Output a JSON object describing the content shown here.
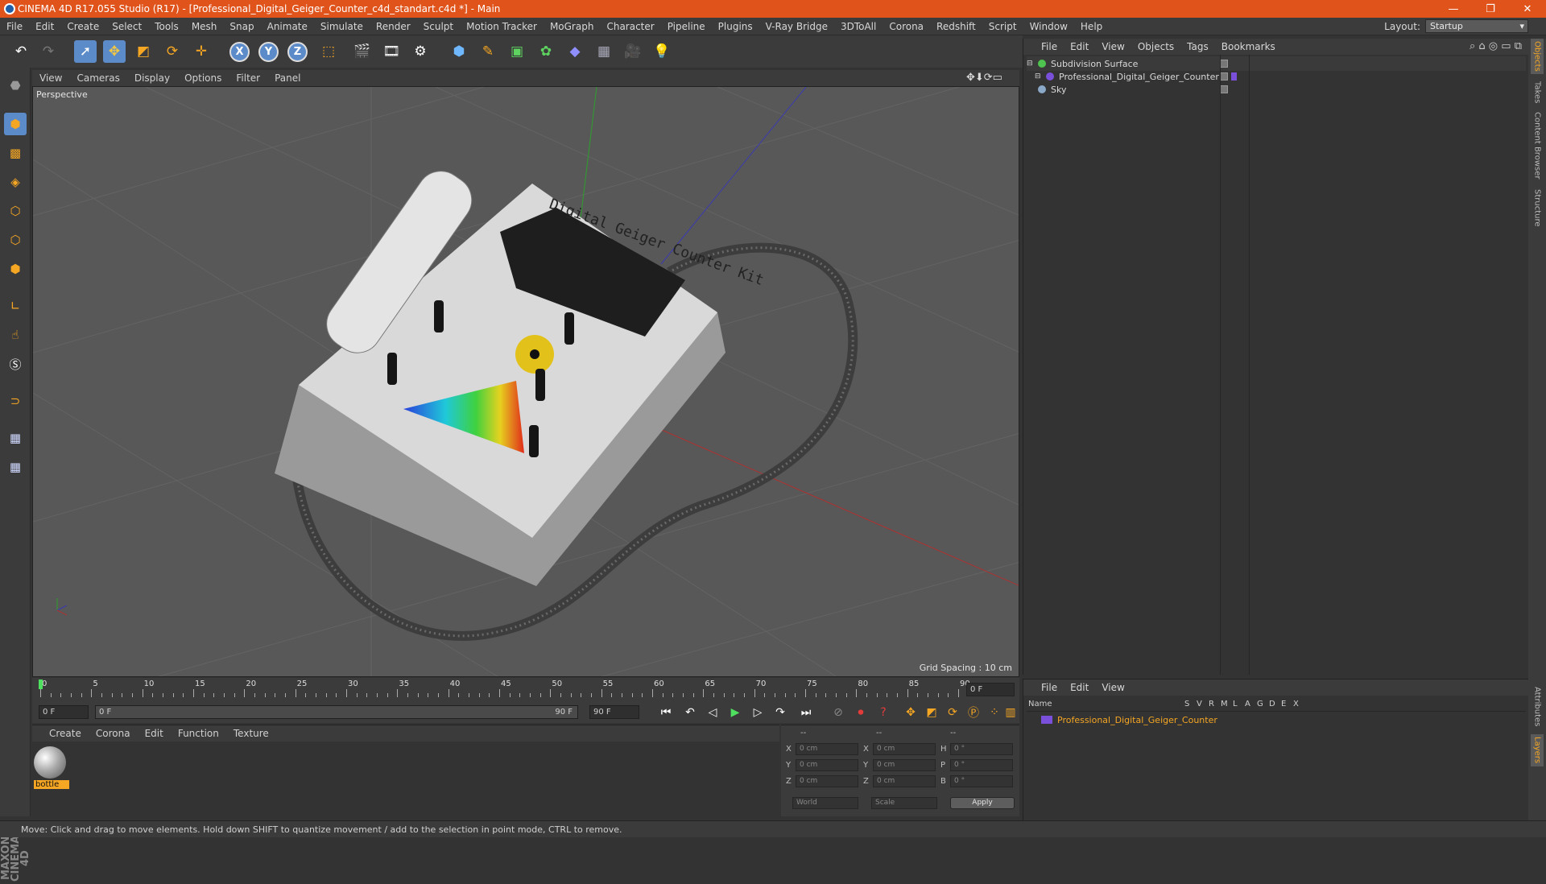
{
  "window": {
    "title": "CINEMA 4D R17.055 Studio (R17) - [Professional_Digital_Geiger_Counter_c4d_standart.c4d *] - Main",
    "minimize": "—",
    "maximize": "❐",
    "close": "✕"
  },
  "menubar": [
    "File",
    "Edit",
    "Create",
    "Select",
    "Tools",
    "Mesh",
    "Snap",
    "Animate",
    "Simulate",
    "Render",
    "Sculpt",
    "Motion Tracker",
    "MoGraph",
    "Character",
    "Pipeline",
    "Plugins",
    "V-Ray Bridge",
    "3DToAll",
    "Corona",
    "Redshift",
    "Script",
    "Window",
    "Help"
  ],
  "layout": {
    "label": "Layout:",
    "value": "Startup"
  },
  "viewport": {
    "menu": [
      "View",
      "Cameras",
      "Display",
      "Options",
      "Filter",
      "Panel"
    ],
    "label": "Perspective",
    "grid_spacing": "Grid Spacing : 10 cm"
  },
  "timeline": {
    "ticks": [
      "0",
      "5",
      "10",
      "15",
      "20",
      "25",
      "30",
      "35",
      "40",
      "45",
      "50",
      "55",
      "60",
      "65",
      "70",
      "75",
      "80",
      "85",
      "90"
    ],
    "current_frame": "0 F"
  },
  "transport": {
    "start": "0 F",
    "range_start": "0 F",
    "range_end": "90 F",
    "end": "90 F"
  },
  "material_manager": {
    "menu": [
      "Create",
      "Corona",
      "Edit",
      "Function",
      "Texture"
    ],
    "materials": [
      {
        "name": "bottle"
      }
    ]
  },
  "attributes": {
    "headers": [
      "--",
      "--",
      "--"
    ],
    "rows": [
      {
        "a": "X",
        "av": "0 cm",
        "b": "X",
        "bv": "0 cm",
        "c": "H",
        "cv": "0 °"
      },
      {
        "a": "Y",
        "av": "0 cm",
        "b": "Y",
        "bv": "0 cm",
        "c": "P",
        "cv": "0 °"
      },
      {
        "a": "Z",
        "av": "0 cm",
        "b": "Z",
        "bv": "0 cm",
        "c": "B",
        "cv": "0 °"
      }
    ],
    "coord_mode": "World",
    "size_mode": "Scale",
    "apply": "Apply"
  },
  "object_manager": {
    "menu": [
      "File",
      "Edit",
      "View",
      "Objects",
      "Tags",
      "Bookmarks"
    ],
    "objects": [
      {
        "name": "Subdivision Surface",
        "icon": "subdivision-icon",
        "color": "#4fc34f"
      },
      {
        "name": "Professional_Digital_Geiger_Counter",
        "icon": "null-object-icon",
        "color": "#7a4fd9"
      },
      {
        "name": "Sky",
        "icon": "sky-icon",
        "color": "#8aa8c8"
      }
    ]
  },
  "layer_manager": {
    "menu": [
      "File",
      "Edit",
      "View"
    ],
    "columns": [
      "Name",
      "S",
      "V",
      "R",
      "M",
      "L",
      "A",
      "G",
      "D",
      "E",
      "X"
    ],
    "layers": [
      {
        "name": "Professional_Digital_Geiger_Counter",
        "color": "#7a4fd9"
      }
    ]
  },
  "side_tabs_top": [
    "Objects",
    "Takes",
    "Content Browser",
    "Structure"
  ],
  "side_tabs_bottom": [
    "Attributes",
    "Layers"
  ],
  "brand": "MAXON CINEMA 4D",
  "model_label": "Digital Geiger Counter Kit",
  "status": "Move: Click and drag to move elements. Hold down SHIFT to quantize movement / add to the selection in point mode, CTRL to remove."
}
